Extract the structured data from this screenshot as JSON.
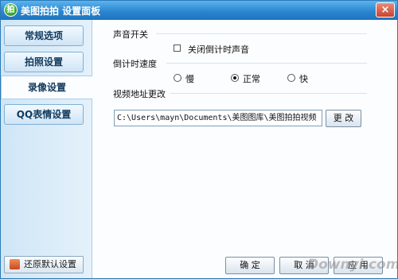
{
  "window": {
    "title": "美图拍拍 设置面板",
    "app_icon_glyph": "拍",
    "close_glyph": "×"
  },
  "sidebar": {
    "items": [
      {
        "label": "常规选项",
        "active": false
      },
      {
        "label": "拍照设置",
        "active": false
      },
      {
        "label": "录像设置",
        "active": true
      },
      {
        "label": "QQ表情设置",
        "active": false
      }
    ],
    "restore_label": "还原默认设置"
  },
  "main": {
    "sound_section": {
      "title": "声音开关",
      "checkbox_label": "关闭倒计时声音",
      "checked": false
    },
    "countdown_section": {
      "title": "倒计时速度",
      "options": [
        {
          "label": "慢",
          "selected": false
        },
        {
          "label": "正常",
          "selected": true
        },
        {
          "label": "快",
          "selected": false
        }
      ]
    },
    "path_section": {
      "title": "视频地址更改",
      "path_value": "C:\\Users\\mayn\\Documents\\美图图库\\美图拍拍视频",
      "change_button": "更 改"
    }
  },
  "footer": {
    "ok": "确 定",
    "cancel": "取 消",
    "apply": "应 用"
  },
  "watermark": "Downyi.com",
  "colors": {
    "titlebar": "#2b87cf",
    "sidebar_bg": "#d6eaf8",
    "accent_border": "#7fb0d6"
  }
}
